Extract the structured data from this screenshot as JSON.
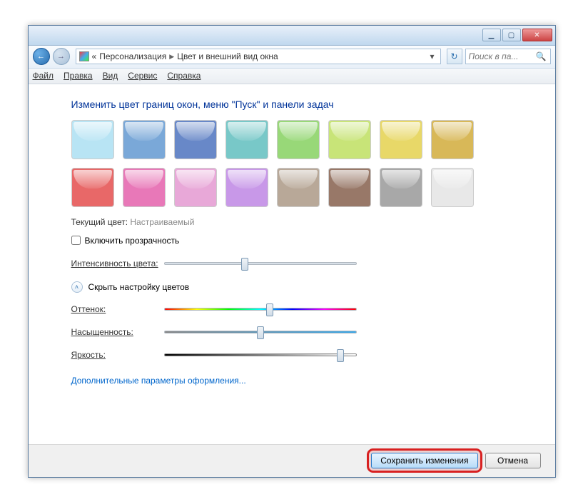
{
  "titlebar": {
    "min_tip": "Свернуть",
    "max_tip": "Развернуть",
    "close_tip": "Закрыть"
  },
  "nav": {
    "back_tip": "Назад",
    "fwd_tip": "Вперед",
    "refresh_tip": "Обновить",
    "crumb_prefix": "«",
    "crumb1": "Персонализация",
    "crumb2": "Цвет и внешний вид окна",
    "search_placeholder": "Поиск в па..."
  },
  "menu": {
    "file": "Файл",
    "edit": "Правка",
    "view": "Вид",
    "tools": "Сервис",
    "help": "Справка"
  },
  "main": {
    "heading": "Изменить цвет границ окон, меню \"Пуск\" и панели задач",
    "colors": [
      "#b8e4f4",
      "#7aa8d8",
      "#6888c8",
      "#78c8c8",
      "#98d878",
      "#c8e478",
      "#e8d868",
      "#d8b858",
      "#e86868",
      "#e878b8",
      "#e8a8d8",
      "#c898e8",
      "#b8a898",
      "#987868",
      "#a8a8a8",
      "#e8e8e8"
    ],
    "current_label": "Текущий цвет:",
    "current_value": "Настраиваемый",
    "transparency_label": "Включить прозрачность",
    "intensity_label": "Интенсивность цвета:",
    "intensity_value": 42,
    "toggle_label": "Скрыть настройку цветов",
    "hue_label": "Оттенок:",
    "hue_value": 55,
    "sat_label": "Насыщенность:",
    "sat_value": 50,
    "bri_label": "Яркость:",
    "bri_value": 92,
    "advanced_link": "Дополнительные параметры оформления..."
  },
  "footer": {
    "save": "Сохранить изменения",
    "cancel": "Отмена"
  }
}
